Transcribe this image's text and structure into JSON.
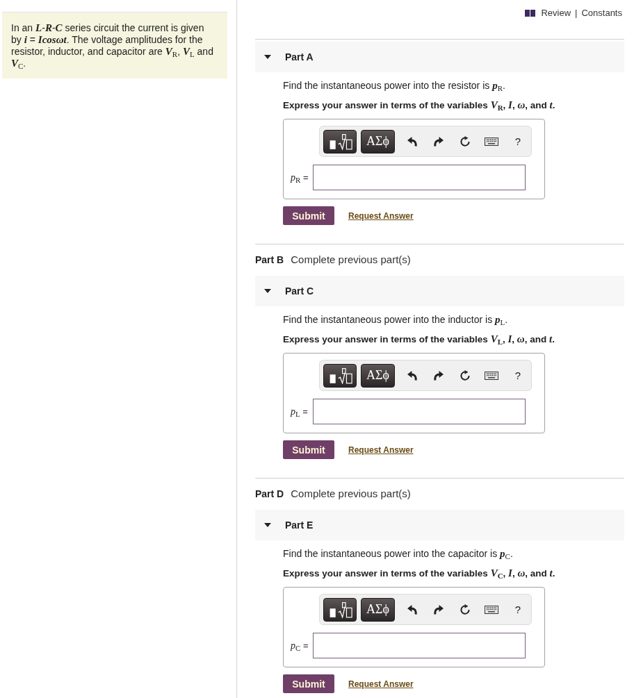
{
  "header_links": {
    "items": [
      {
        "label": "Review"
      },
      {
        "label": "Constants"
      }
    ],
    "separator": "|"
  },
  "intro": "In an *L*-*R*-*C* series circuit the current is given by *i* = *Icosωt*. The voltage amplitudes for the resistor, inductor, and capacitor are *V*$_{R}$, *V*$_{L}$ and *V*$_{C}$.",
  "parts": [
    {
      "kind": "open",
      "label": "Part A",
      "expanded": true,
      "prompt": "Find the instantaneous power into the resistor is *p*$_{R}$.",
      "instruction": "Express your answer in terms of the variables *V*$_{R}$, *I*, *ω*, and *t*.",
      "toolbar": [
        {
          "kind": "templates"
        },
        {
          "kind": "symbols",
          "label": "ΑΣϕ"
        },
        {
          "kind": "undo"
        },
        {
          "kind": "redo"
        },
        {
          "kind": "reset"
        },
        {
          "kind": "keyboard"
        },
        {
          "kind": "help",
          "label": "?"
        }
      ],
      "answer_label": "*p*$_{R}$ =",
      "submit": "Submit",
      "request": "Request Answer"
    },
    {
      "kind": "locked",
      "label": "Part B",
      "status": "Complete previous part(s)"
    },
    {
      "kind": "open",
      "label": "Part C",
      "expanded": true,
      "prompt": "Find the instantaneous power into the inductor is *p*$_{L}$.",
      "instruction": "Express your answer in terms of the variables *V*$_{L}$, *I*, *ω*, and *t*.",
      "toolbar": [
        {
          "kind": "templates"
        },
        {
          "kind": "symbols",
          "label": "ΑΣϕ"
        },
        {
          "kind": "undo"
        },
        {
          "kind": "redo"
        },
        {
          "kind": "reset"
        },
        {
          "kind": "keyboard"
        },
        {
          "kind": "help",
          "label": "?"
        }
      ],
      "answer_label": "*p*$_{L}$ =",
      "submit": "Submit",
      "request": "Request Answer"
    },
    {
      "kind": "locked",
      "label": "Part D",
      "status": "Complete previous part(s)"
    },
    {
      "kind": "open",
      "label": "Part E",
      "expanded": true,
      "prompt": "Find the instantaneous power into the capacitor is *p*$_{C}$.",
      "instruction": "Express your answer in terms of the variables *V*$_{C}$, *I*, *ω*, and *t*.",
      "toolbar": [
        {
          "kind": "templates"
        },
        {
          "kind": "symbols",
          "label": "ΑΣϕ"
        },
        {
          "kind": "undo"
        },
        {
          "kind": "redo"
        },
        {
          "kind": "reset"
        },
        {
          "kind": "keyboard"
        },
        {
          "kind": "help",
          "label": "?"
        }
      ],
      "answer_label": "*p*$_{C}$ =",
      "submit": "Submit",
      "request": "Request Answer"
    }
  ]
}
